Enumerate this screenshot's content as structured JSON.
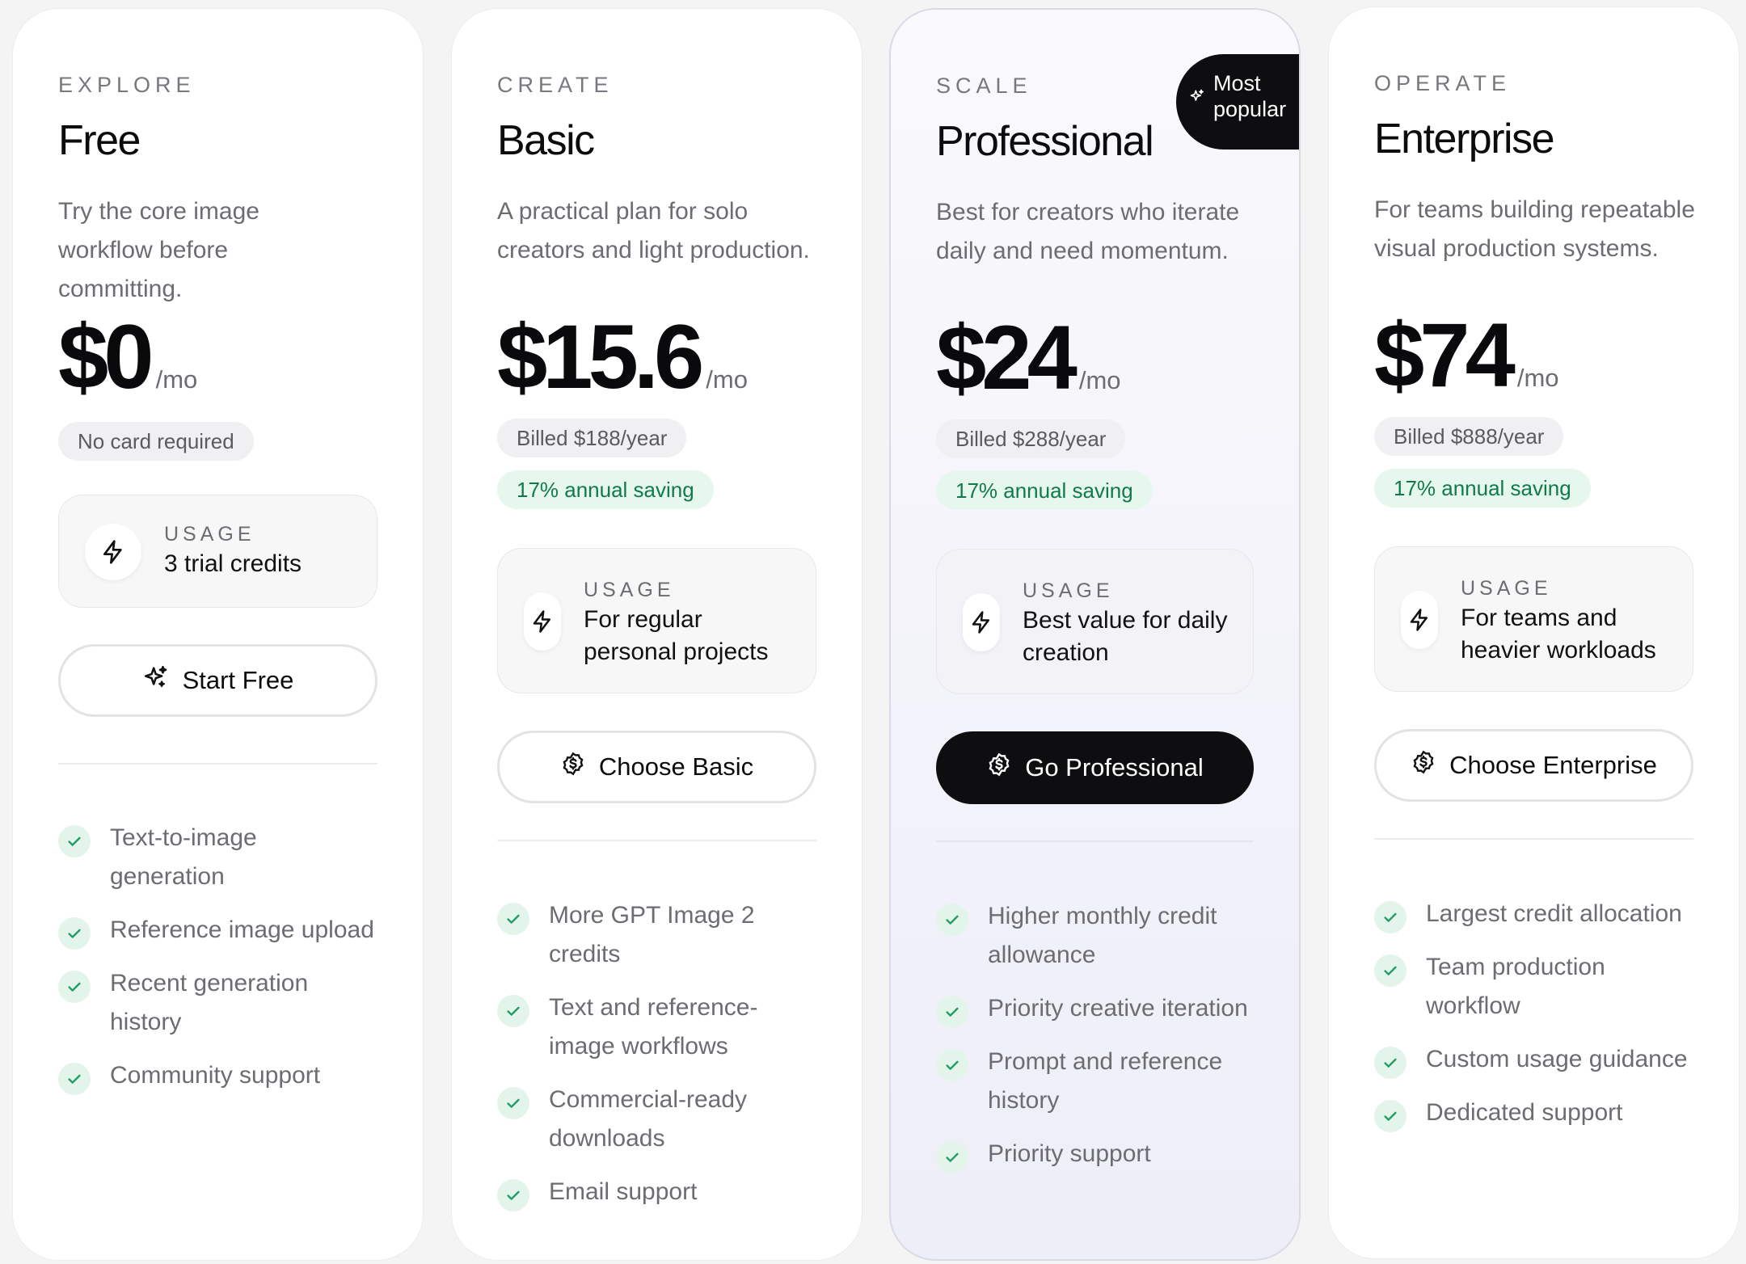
{
  "plans": [
    {
      "tier": "EXPLORE",
      "name": "Free",
      "description": "Try the core image workflow before committing.",
      "price": "$0",
      "period": "/mo",
      "billing": "No card required",
      "saving": "",
      "usage_label": "USAGE",
      "usage_value": "3 trial credits",
      "cta": "Start Free",
      "cta_icon": "sparkles-icon",
      "features": [
        "Text-to-image generation",
        "Reference image upload",
        "Recent generation history",
        "Community support"
      ]
    },
    {
      "tier": "CREATE",
      "name": "Basic",
      "description": "A practical plan for solo creators and light production.",
      "price": "$15.6",
      "period": "/mo",
      "billing": "Billed $188/year",
      "saving": "17% annual saving",
      "usage_label": "USAGE",
      "usage_value": "For regular personal projects",
      "cta": "Choose Basic",
      "cta_icon": "dollar-circle-icon",
      "features": [
        "More GPT Image 2 credits",
        "Text and reference-image workflows",
        "Commercial-ready downloads",
        "Email support"
      ]
    },
    {
      "tier": "SCALE",
      "name": "Professional",
      "description": "Best for creators who iterate daily and need momentum.",
      "price": "$24",
      "period": "/mo",
      "billing": "Billed $288/year",
      "saving": "17% annual saving",
      "usage_label": "USAGE",
      "usage_value": "Best value for daily creation",
      "cta": "Go Professional",
      "cta_icon": "dollar-circle-icon",
      "badge": "Most popular",
      "features": [
        "Higher monthly credit allowance",
        "Priority creative iteration",
        "Prompt and reference history",
        "Priority support"
      ]
    },
    {
      "tier": "OPERATE",
      "name": "Enterprise",
      "description": "For teams building repeatable visual production systems.",
      "price": "$74",
      "period": "/mo",
      "billing": "Billed $888/year",
      "saving": "17% annual saving",
      "usage_label": "USAGE",
      "usage_value": "For teams and heavier workloads",
      "cta": "Choose Enterprise",
      "cta_icon": "dollar-circle-icon",
      "features": [
        "Largest credit allocation",
        "Team production workflow",
        "Custom usage guidance",
        "Dedicated support"
      ]
    }
  ],
  "colors": {
    "accent_dark": "#0e0e10",
    "check_green": "#1f9d62",
    "saving_bg": "#e6f7ee",
    "saving_text": "#127a4a"
  }
}
